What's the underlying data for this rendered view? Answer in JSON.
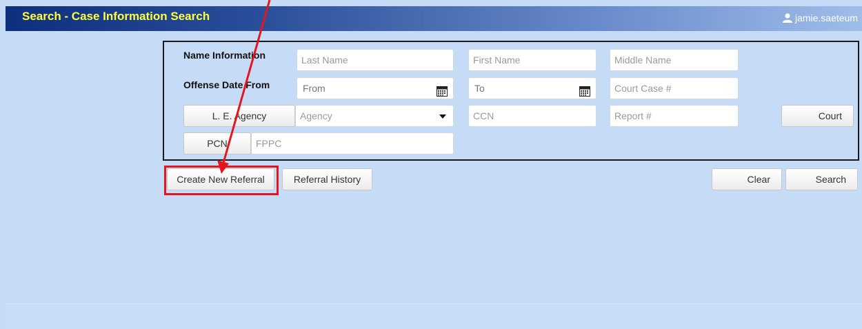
{
  "header": {
    "title": "Search - Case Information Search",
    "username": "jamie.saeteum"
  },
  "search": {
    "name_label": "Name Information",
    "offense_date_label": "Offense Date From",
    "last_name_placeholder": "Last Name",
    "first_name_placeholder": "First Name",
    "middle_name_placeholder": "Middle Name",
    "from_placeholder": "From",
    "to_placeholder": "To",
    "court_case_placeholder": "Court Case #",
    "le_agency_label": "L. E. Agency",
    "agency_select_value": "Agency",
    "ccn_placeholder": "CCN",
    "report_placeholder": "Report #",
    "court_label": "Court",
    "pcn_label": "PCN",
    "fppc_placeholder": "FPPC"
  },
  "actions": {
    "create_new_referral": "Create New Referral",
    "referral_history": "Referral History",
    "clear": "Clear",
    "search": "Search"
  },
  "annotation": {
    "color": "#e6141b"
  },
  "icons": {
    "user": "user-icon",
    "calendar": "calendar-icon",
    "dropdown": "caret-down-icon"
  }
}
